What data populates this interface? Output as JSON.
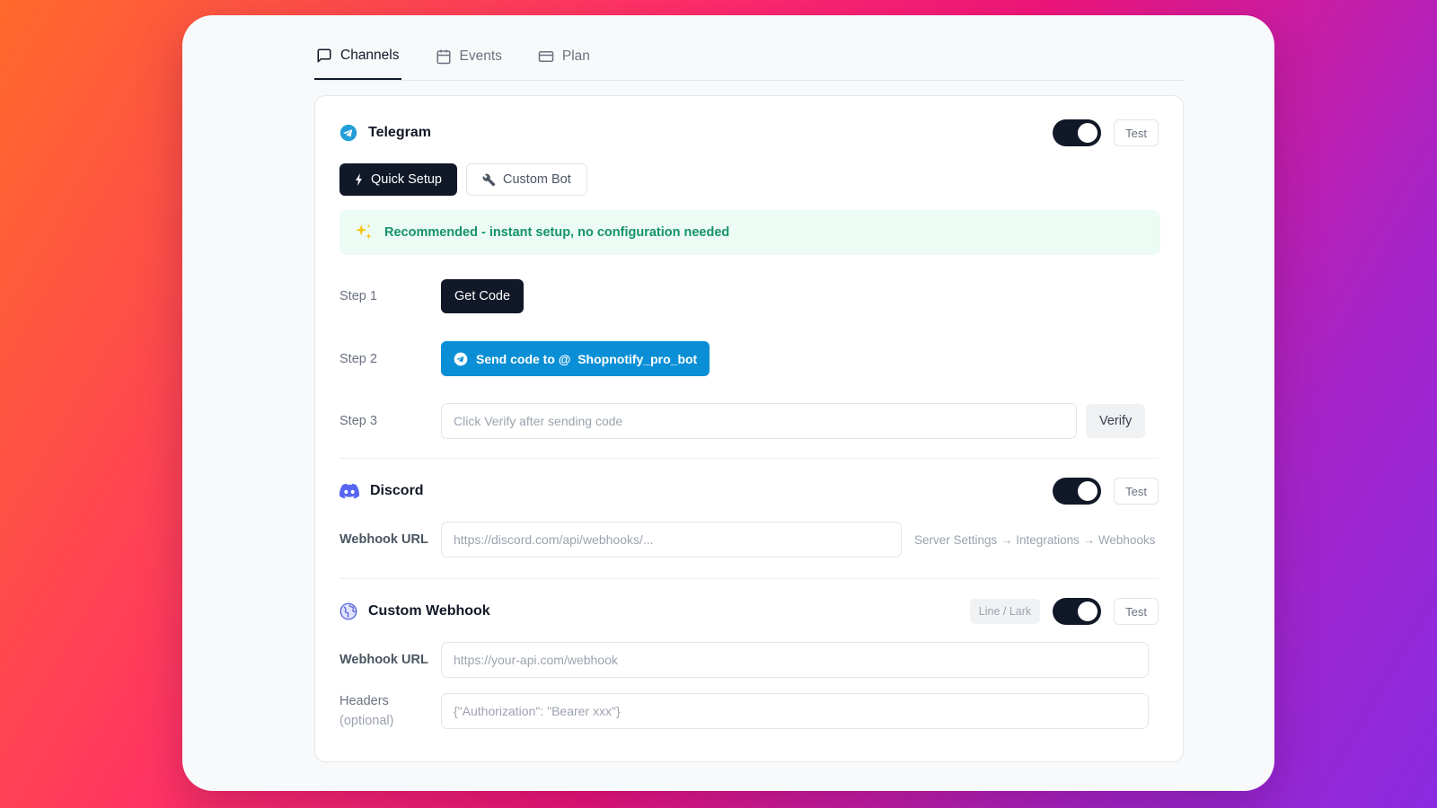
{
  "tabs": [
    {
      "label": "Channels",
      "icon": "message-square-icon",
      "active": true
    },
    {
      "label": "Events",
      "icon": "calendar-icon",
      "active": false
    },
    {
      "label": "Plan",
      "icon": "credit-card-icon",
      "active": false
    }
  ],
  "telegram": {
    "title": "Telegram",
    "icon": "telegram-icon",
    "enabled": true,
    "test_label": "Test",
    "quick_setup_label": "Quick Setup",
    "custom_bot_label": "Custom Bot",
    "notice_icon": "sparkles-icon",
    "notice": "Recommended - instant setup, no configuration needed",
    "step1_label": "Step 1",
    "get_code_label": "Get Code",
    "step2_label": "Step 2",
    "send_code_label": "Send code to @  Shopnotify_pro_bot",
    "step3_label": "Step 3",
    "verify_placeholder": "Click Verify after sending code",
    "verify_label": "Verify"
  },
  "discord": {
    "title": "Discord",
    "icon": "discord-icon",
    "enabled": true,
    "test_label": "Test",
    "webhook_label": "Webhook URL",
    "webhook_placeholder": "https://discord.com/api/webhooks/...",
    "hint": "Server Settings → Integrations → Webhooks"
  },
  "custom_webhook": {
    "title": "Custom Webhook",
    "icon": "globe-icon",
    "badge": "Line / Lark",
    "enabled": true,
    "test_label": "Test",
    "webhook_label": "Webhook URL",
    "webhook_placeholder": "https://your-api.com/webhook",
    "headers_label": "Headers",
    "headers_sub": "(optional)",
    "headers_placeholder": "{\"Authorization\": \"Bearer xxx\"}"
  },
  "colors": {
    "accent_dark": "#111827",
    "telegram_blue": "#0a8fd6",
    "discord_purple": "#5865f2",
    "success_green": "#15936a"
  }
}
